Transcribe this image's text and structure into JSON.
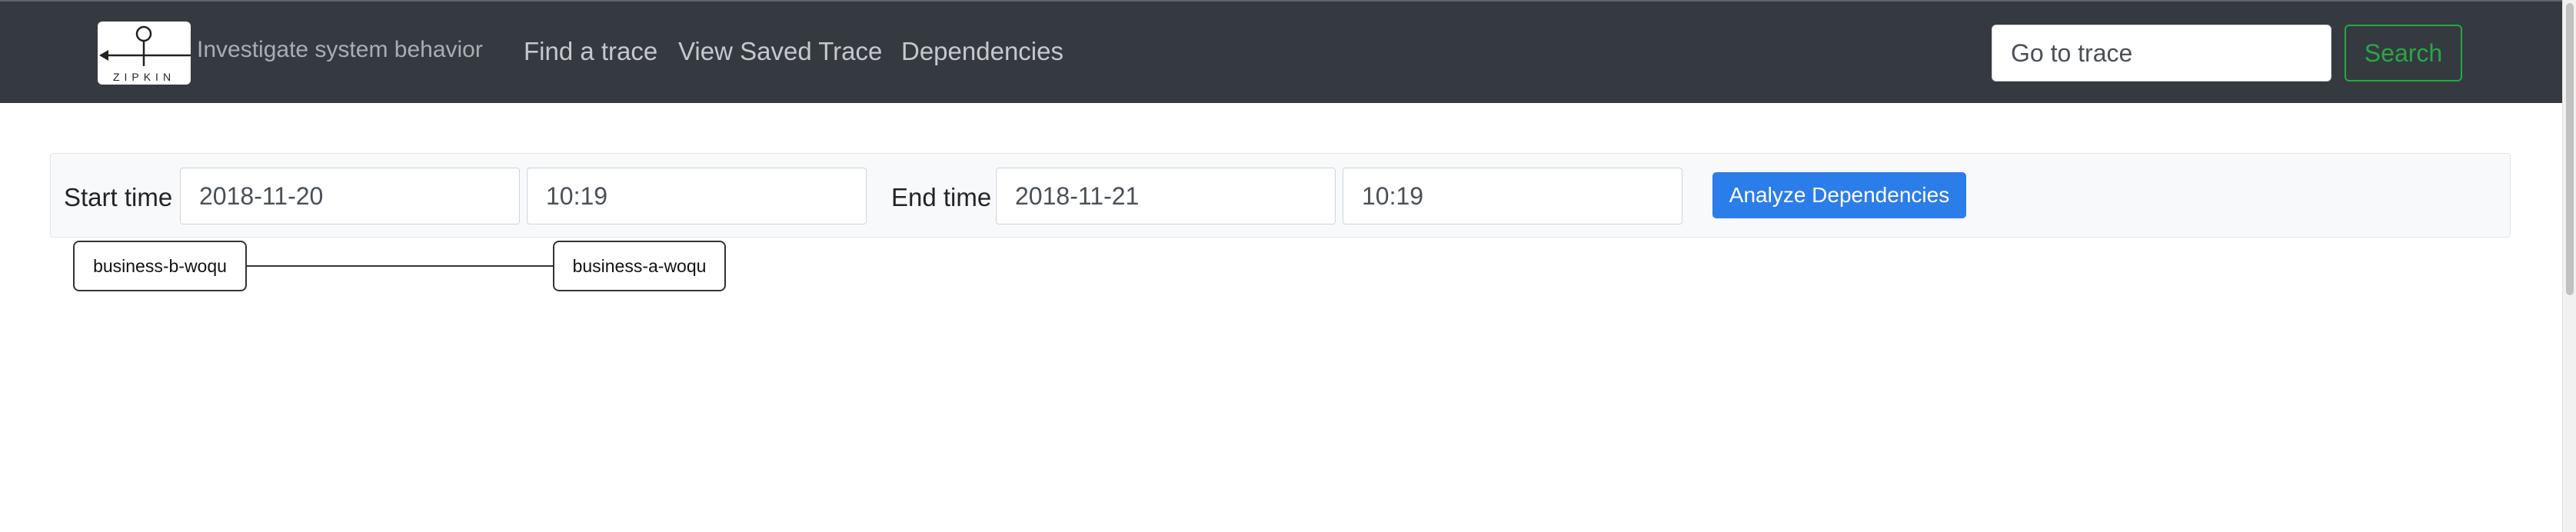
{
  "header": {
    "logo_text": "ZIPKIN",
    "tagline": "Investigate system behavior",
    "nav": [
      {
        "label": "Find a trace"
      },
      {
        "label": "View Saved Trace"
      },
      {
        "label": "Dependencies"
      }
    ],
    "search": {
      "placeholder": "Go to trace",
      "button_label": "Search"
    }
  },
  "filters": {
    "start_label": "Start time",
    "start_date": "2018-11-20",
    "start_time": "10:19",
    "end_label": "End time",
    "end_date": "2018-11-21",
    "end_time": "10:19",
    "analyze_label": "Analyze Dependencies"
  },
  "graph": {
    "nodes": [
      {
        "label": "business-b-woqu"
      },
      {
        "label": "business-a-woqu"
      }
    ],
    "edges": [
      {
        "from": "business-b-woqu",
        "to": "business-a-woqu"
      }
    ]
  },
  "colors": {
    "navbar": "#343a40",
    "search_button": "#28a745",
    "analyze_button": "#2b7de9"
  }
}
